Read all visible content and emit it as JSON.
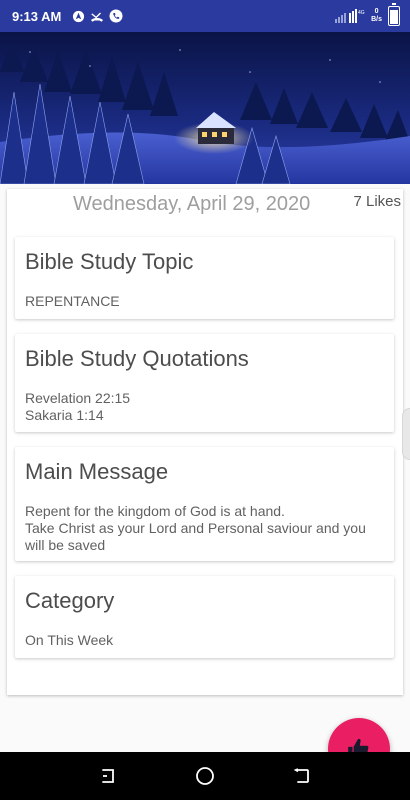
{
  "status_bar": {
    "time": "9:13 AM",
    "left_icons": [
      "navigation-icon",
      "missed-call-icon",
      "phone-icon"
    ],
    "net_speed_value": "0",
    "net_speed_unit": "B/s",
    "signal_label": "4G"
  },
  "post": {
    "date": "Wednesday, April 29, 2020",
    "likes": "7 Likes"
  },
  "sections": [
    {
      "title": "Bible Study Topic",
      "lines": [
        "REPENTANCE"
      ]
    },
    {
      "title": "Bible Study Quotations",
      "lines": [
        "Revelation 22:15",
        "Sakaria 1:14"
      ]
    },
    {
      "title": "Main Message",
      "lines": [
        "Repent for the kingdom of God is at hand.",
        "Take Christ as your Lord and Personal saviour and you will be saved"
      ]
    },
    {
      "title": "Category",
      "lines": [
        "On This Week"
      ]
    }
  ],
  "fab": {
    "icon": "thumbs-up-icon",
    "color": "#e91e63"
  },
  "nav": {
    "icons": [
      "recent-apps-icon",
      "home-icon",
      "back-icon"
    ]
  },
  "colors": {
    "status_bar": "#2b3a9e",
    "accent": "#e91e63"
  }
}
